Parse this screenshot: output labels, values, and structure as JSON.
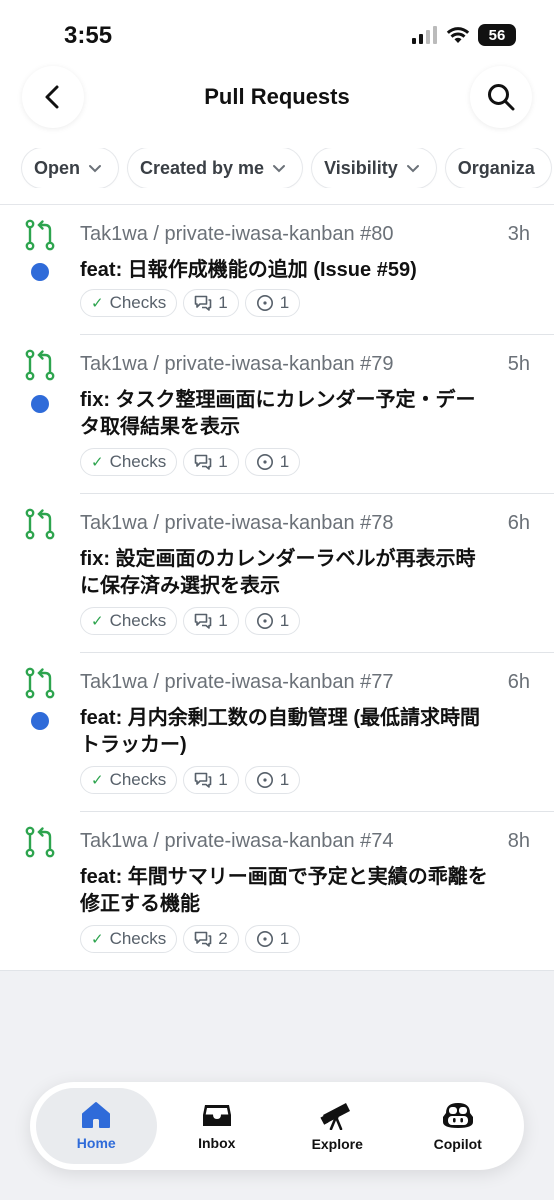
{
  "status_bar": {
    "time": "3:55",
    "battery": "56"
  },
  "header": {
    "title": "Pull Requests"
  },
  "filters": [
    {
      "label": "Open"
    },
    {
      "label": "Created by me"
    },
    {
      "label": "Visibility"
    },
    {
      "label": "Organiza"
    }
  ],
  "pull_requests": [
    {
      "repo": "Tak1wa / private-iwasa-kanban #80",
      "time": "3h",
      "title": "feat: 日報作成機能の追加 (Issue #59)",
      "unread": true,
      "checks": "Checks",
      "comments": "1",
      "issues": "1"
    },
    {
      "repo": "Tak1wa / private-iwasa-kanban #79",
      "time": "5h",
      "title": "fix: タスク整理画面にカレンダー予定・データ取得結果を表示",
      "unread": true,
      "checks": "Checks",
      "comments": "1",
      "issues": "1"
    },
    {
      "repo": "Tak1wa / private-iwasa-kanban #78",
      "time": "6h",
      "title": "fix: 設定画面のカレンダーラベルが再表示時に保存済み選択を表示",
      "unread": false,
      "checks": "Checks",
      "comments": "1",
      "issues": "1"
    },
    {
      "repo": "Tak1wa / private-iwasa-kanban #77",
      "time": "6h",
      "title": "feat: 月内余剰工数の自動管理 (最低請求時間トラッカー)",
      "unread": true,
      "checks": "Checks",
      "comments": "1",
      "issues": "1"
    },
    {
      "repo": "Tak1wa / private-iwasa-kanban #74",
      "time": "8h",
      "title": "feat: 年間サマリー画面で予定と実績の乖離を修正する機能",
      "unread": false,
      "checks": "Checks",
      "comments": "2",
      "issues": "1"
    }
  ],
  "tabbar": [
    {
      "label": "Home",
      "icon": "home-icon",
      "active": true
    },
    {
      "label": "Inbox",
      "icon": "inbox-icon",
      "active": false
    },
    {
      "label": "Explore",
      "icon": "telescope-icon",
      "active": false
    },
    {
      "label": "Copilot",
      "icon": "copilot-icon",
      "active": false
    }
  ],
  "colors": {
    "accent": "#2f6bd9",
    "pr_open": "#2da44e",
    "muted": "#6b7178"
  }
}
